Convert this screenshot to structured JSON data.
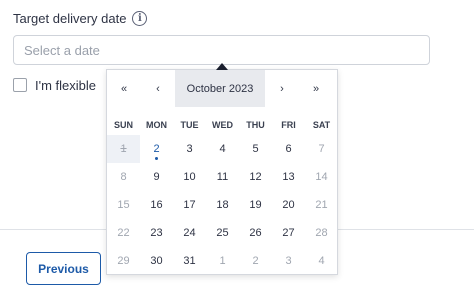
{
  "form": {
    "label": "Target delivery date",
    "info_icon": "info-icon",
    "date_placeholder": "Select a date",
    "flexible_label": "I'm flexible"
  },
  "footer": {
    "previous_label": "Previous"
  },
  "calendar": {
    "title": "October 2023",
    "nav": {
      "prev_year": "«",
      "prev_month": "‹",
      "next_month": "›",
      "next_year": "»"
    },
    "weekdays": [
      "SUN",
      "MON",
      "TUE",
      "WED",
      "THU",
      "FRI",
      "SAT"
    ],
    "weeks": [
      [
        {
          "label": "1",
          "state": "disabled"
        },
        {
          "label": "2",
          "state": "today"
        },
        {
          "label": "3",
          "state": "normal"
        },
        {
          "label": "4",
          "state": "normal"
        },
        {
          "label": "5",
          "state": "normal"
        },
        {
          "label": "6",
          "state": "normal"
        },
        {
          "label": "7",
          "state": "other"
        }
      ],
      [
        {
          "label": "8",
          "state": "other"
        },
        {
          "label": "9",
          "state": "normal"
        },
        {
          "label": "10",
          "state": "normal"
        },
        {
          "label": "11",
          "state": "normal"
        },
        {
          "label": "12",
          "state": "normal"
        },
        {
          "label": "13",
          "state": "normal"
        },
        {
          "label": "14",
          "state": "other"
        }
      ],
      [
        {
          "label": "15",
          "state": "other"
        },
        {
          "label": "16",
          "state": "normal"
        },
        {
          "label": "17",
          "state": "normal"
        },
        {
          "label": "18",
          "state": "normal"
        },
        {
          "label": "19",
          "state": "normal"
        },
        {
          "label": "20",
          "state": "normal"
        },
        {
          "label": "21",
          "state": "other"
        }
      ],
      [
        {
          "label": "22",
          "state": "other"
        },
        {
          "label": "23",
          "state": "normal"
        },
        {
          "label": "24",
          "state": "normal"
        },
        {
          "label": "25",
          "state": "normal"
        },
        {
          "label": "26",
          "state": "normal"
        },
        {
          "label": "27",
          "state": "normal"
        },
        {
          "label": "28",
          "state": "other"
        }
      ],
      [
        {
          "label": "29",
          "state": "other"
        },
        {
          "label": "30",
          "state": "normal"
        },
        {
          "label": "31",
          "state": "normal"
        },
        {
          "label": "1",
          "state": "other"
        },
        {
          "label": "2",
          "state": "other"
        },
        {
          "label": "3",
          "state": "other"
        },
        {
          "label": "4",
          "state": "other"
        }
      ]
    ]
  },
  "colors": {
    "accent": "#1d5aa8",
    "muted_text": "#a0a6b0",
    "header_bg": "#e8eaee",
    "disabled_bg": "#eef1f6"
  }
}
